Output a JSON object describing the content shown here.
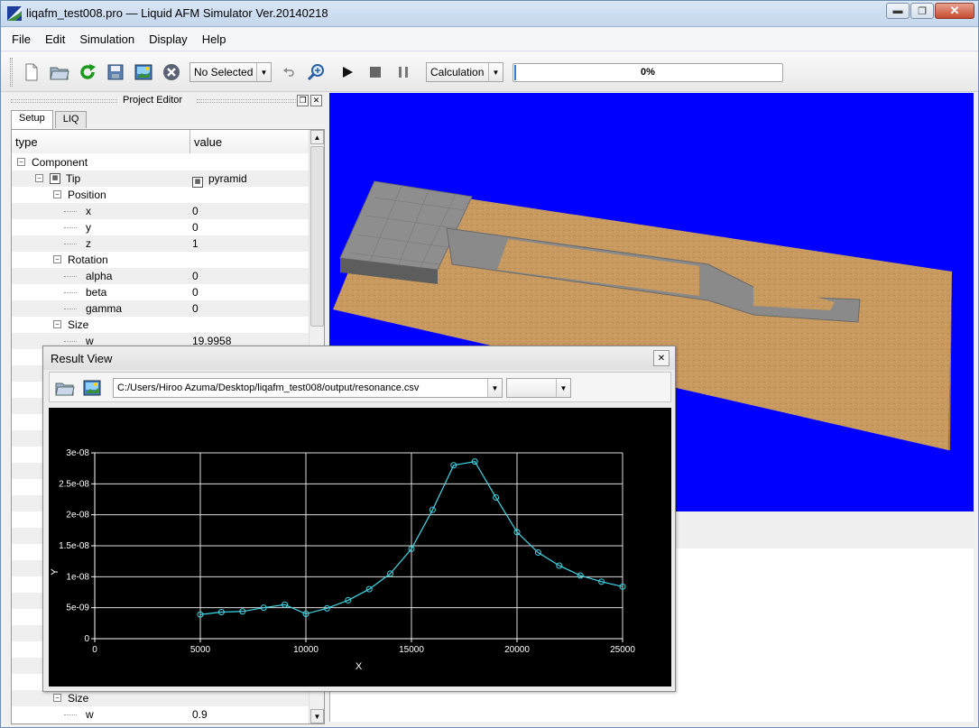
{
  "window": {
    "title": "liqafm_test008.pro — Liquid AFM Simulator Ver.20140218",
    "min_label": "▬",
    "max_label": "❐",
    "close_label": "✕"
  },
  "menu": [
    "File",
    "Edit",
    "Simulation",
    "Display",
    "Help"
  ],
  "toolbar": {
    "component_combo": "No Selected",
    "mode_combo": "Calculation",
    "progress_text": "0%",
    "progress_value": 0
  },
  "dock": {
    "title": "Project Editor",
    "tabs": [
      "Setup",
      "LIQ"
    ],
    "columns": [
      "type",
      "value"
    ],
    "rows": [
      {
        "name": "Component",
        "value": "",
        "level": 0,
        "exp": "−"
      },
      {
        "name": "Tip",
        "value": "pyramid",
        "level": 1,
        "exp": "−",
        "icon": true
      },
      {
        "name": "Position",
        "value": "",
        "level": 2,
        "exp": "−"
      },
      {
        "name": "x",
        "value": "0",
        "level": 3
      },
      {
        "name": "y",
        "value": "0",
        "level": 3
      },
      {
        "name": "z",
        "value": "1",
        "level": 3
      },
      {
        "name": "Rotation",
        "value": "",
        "level": 2,
        "exp": "−"
      },
      {
        "name": "alpha",
        "value": "0",
        "level": 3
      },
      {
        "name": "beta",
        "value": "0",
        "level": 3
      },
      {
        "name": "gamma",
        "value": "0",
        "level": 3
      },
      {
        "name": "Size",
        "value": "",
        "level": 2,
        "exp": "−"
      },
      {
        "name": "w",
        "value": "19.9958",
        "level": 3
      }
    ],
    "bottom_rows": [
      {
        "name": "Size",
        "value": "",
        "level": 2,
        "exp": "−"
      },
      {
        "name": "w",
        "value": "0.9",
        "level": 3
      }
    ]
  },
  "result_view": {
    "title": "Result View",
    "close_label": "✕",
    "path": "C:/Users/Hiroo Azuma/Desktop/liqafm_test008/output/resonance.csv"
  },
  "colors": {
    "view_bg": "#0000ff",
    "plot_line": "#40d8e8",
    "progress": "#2f7bd6",
    "sand": "#c99a60"
  },
  "chart_data": {
    "type": "line",
    "xlabel": "X",
    "ylabel": "Y",
    "xlim": [
      0,
      25000
    ],
    "ylim": [
      0,
      3e-08
    ],
    "x_ticks": [
      "0",
      "5000",
      "10000",
      "15000",
      "20000",
      "25000"
    ],
    "y_ticks": [
      "0",
      "5e-09",
      "1e-08",
      "1.5e-08",
      "2e-08",
      "2.5e-08",
      "3e-08"
    ],
    "grid": true,
    "series": [
      {
        "x": [
          5000,
          6000,
          7000,
          8000,
          9000,
          10000,
          11000,
          12000,
          13000,
          14000,
          15000,
          16000,
          17000,
          18000,
          19000,
          20000,
          21000,
          22000,
          23000,
          24000,
          25000
        ],
        "y": [
          3.9e-09,
          4.3e-09,
          4.4e-09,
          5e-09,
          5.5e-09,
          4e-09,
          4.9e-09,
          6.2e-09,
          8e-09,
          1.05e-08,
          1.45e-08,
          2.08e-08,
          2.8e-08,
          2.86e-08,
          2.28e-08,
          1.72e-08,
          1.39e-08,
          1.18e-08,
          1.02e-08,
          9.2e-09,
          8.4e-09
        ]
      }
    ]
  }
}
